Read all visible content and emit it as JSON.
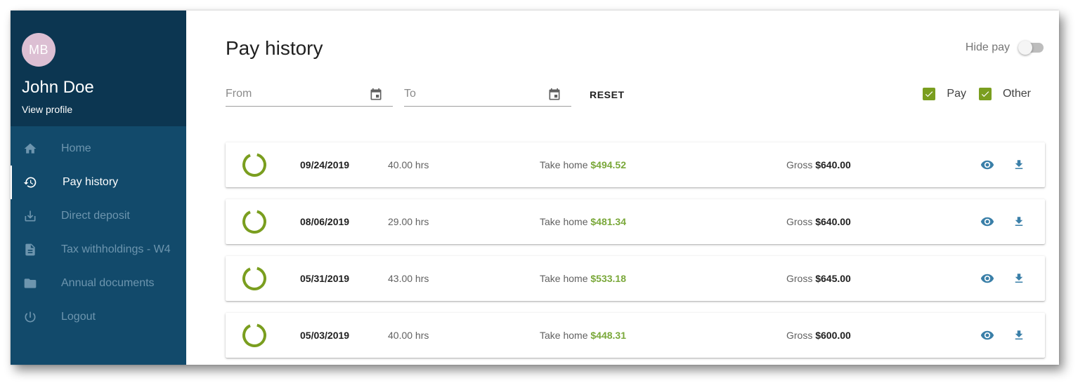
{
  "sidebar": {
    "avatar_initials": "MB",
    "user_name": "John Doe",
    "view_profile": "View profile",
    "items": [
      {
        "id": "home",
        "label": "Home",
        "icon": "home-icon"
      },
      {
        "id": "pay-history",
        "label": "Pay history",
        "icon": "history-icon",
        "active": true
      },
      {
        "id": "direct-deposit",
        "label": "Direct deposit",
        "icon": "download-icon"
      },
      {
        "id": "tax-withholdings",
        "label": "Tax withholdings - W4",
        "icon": "document-icon"
      },
      {
        "id": "annual-documents",
        "label": "Annual documents",
        "icon": "folder-icon"
      },
      {
        "id": "logout",
        "label": "Logout",
        "icon": "power-icon"
      }
    ]
  },
  "main": {
    "title": "Pay history",
    "hide_pay_label": "Hide pay",
    "hide_pay_on": false,
    "from_placeholder": "From",
    "to_placeholder": "To",
    "reset_label": "RESET",
    "filters": [
      {
        "label": "Pay",
        "checked": true
      },
      {
        "label": "Other",
        "checked": true
      }
    ],
    "take_home_label": "Take home",
    "gross_label": "Gross",
    "rows": [
      {
        "date": "09/24/2019",
        "hours": "40.00 hrs",
        "take_home": "$494.52",
        "gross": "$640.00"
      },
      {
        "date": "08/06/2019",
        "hours": "29.00 hrs",
        "take_home": "$481.34",
        "gross": "$640.00"
      },
      {
        "date": "05/31/2019",
        "hours": "43.00 hrs",
        "take_home": "$533.18",
        "gross": "$645.00"
      },
      {
        "date": "05/03/2019",
        "hours": "40.00 hrs",
        "take_home": "$448.31",
        "gross": "$600.00"
      }
    ]
  },
  "colors": {
    "sidebar_bg": "#124a6b",
    "profile_bg": "#0c3651",
    "accent_green": "#7a9e1f",
    "money_green": "#7aa83a",
    "icon_blue": "#3a7fa8"
  }
}
